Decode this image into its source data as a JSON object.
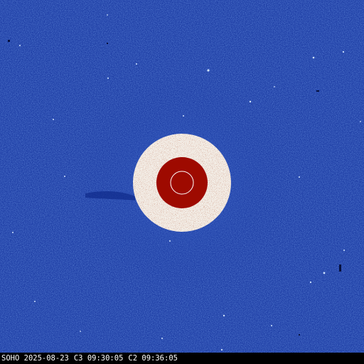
{
  "image": {
    "observatory": "SOHO",
    "date": "2025-08-23",
    "c3_label": "C3",
    "c3_time": "09:30:05",
    "c2_label": "C2",
    "c2_time": "09:36:05"
  },
  "colors": {
    "sky_base": "#1f3fa6",
    "sky_dark": "#0e2a8a",
    "sky_light": "#3a63c8",
    "occulter_outer": "#f4efe8",
    "occulter_speckle": "#7a2a18",
    "occulter_inner": "#9e0a00",
    "sun_limb": "#ffffff",
    "caption_bg": "#000000",
    "caption_text": "#ffffff"
  }
}
